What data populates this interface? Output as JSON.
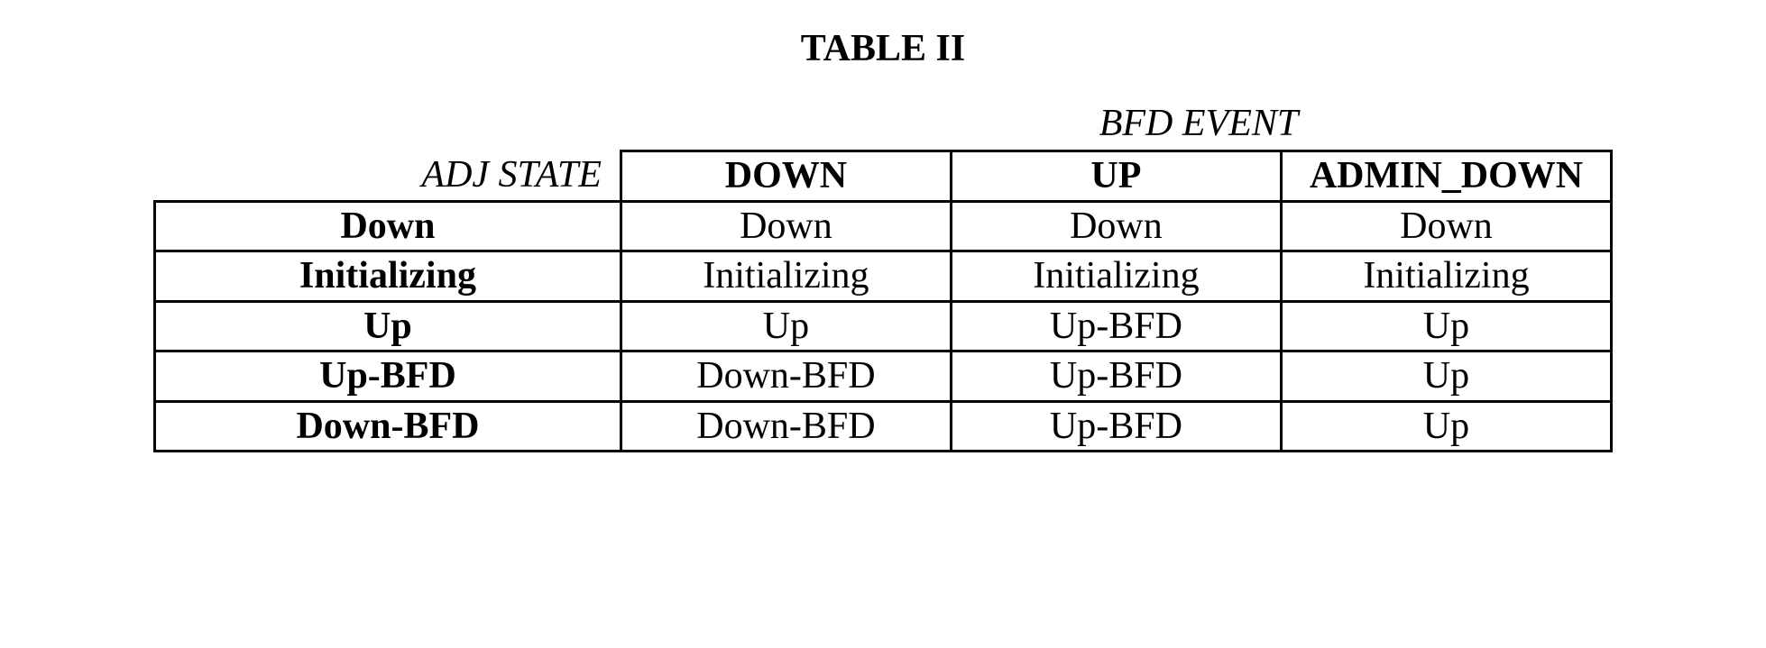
{
  "title": "TABLE II",
  "superHeader": "BFD EVENT",
  "headers": {
    "adjState": "ADJ STATE",
    "down": "DOWN",
    "up": "UP",
    "adminDown": "ADMIN_DOWN"
  },
  "rows": [
    {
      "state": "Down",
      "down": "Down",
      "up": "Down",
      "adminDown": "Down"
    },
    {
      "state": "Initializing",
      "down": "Initializing",
      "up": "Initializing",
      "adminDown": "Initializing"
    },
    {
      "state": "Up",
      "down": "Up",
      "up": "Up-BFD",
      "adminDown": "Up"
    },
    {
      "state": "Up-BFD",
      "down": "Down-BFD",
      "up": "Up-BFD",
      "adminDown": "Up"
    },
    {
      "state": "Down-BFD",
      "down": "Down-BFD",
      "up": "Up-BFD",
      "adminDown": "Up"
    }
  ],
  "chart_data": {
    "type": "table",
    "title": "TABLE II",
    "column_group_label": "BFD EVENT",
    "row_group_label": "ADJ STATE",
    "columns": [
      "DOWN",
      "UP",
      "ADMIN_DOWN"
    ],
    "rows": [
      "Down",
      "Initializing",
      "Up",
      "Up-BFD",
      "Down-BFD"
    ],
    "values": [
      [
        "Down",
        "Down",
        "Down"
      ],
      [
        "Initializing",
        "Initializing",
        "Initializing"
      ],
      [
        "Up",
        "Up-BFD",
        "Up"
      ],
      [
        "Down-BFD",
        "Up-BFD",
        "Up"
      ],
      [
        "Down-BFD",
        "Up-BFD",
        "Up"
      ]
    ]
  }
}
